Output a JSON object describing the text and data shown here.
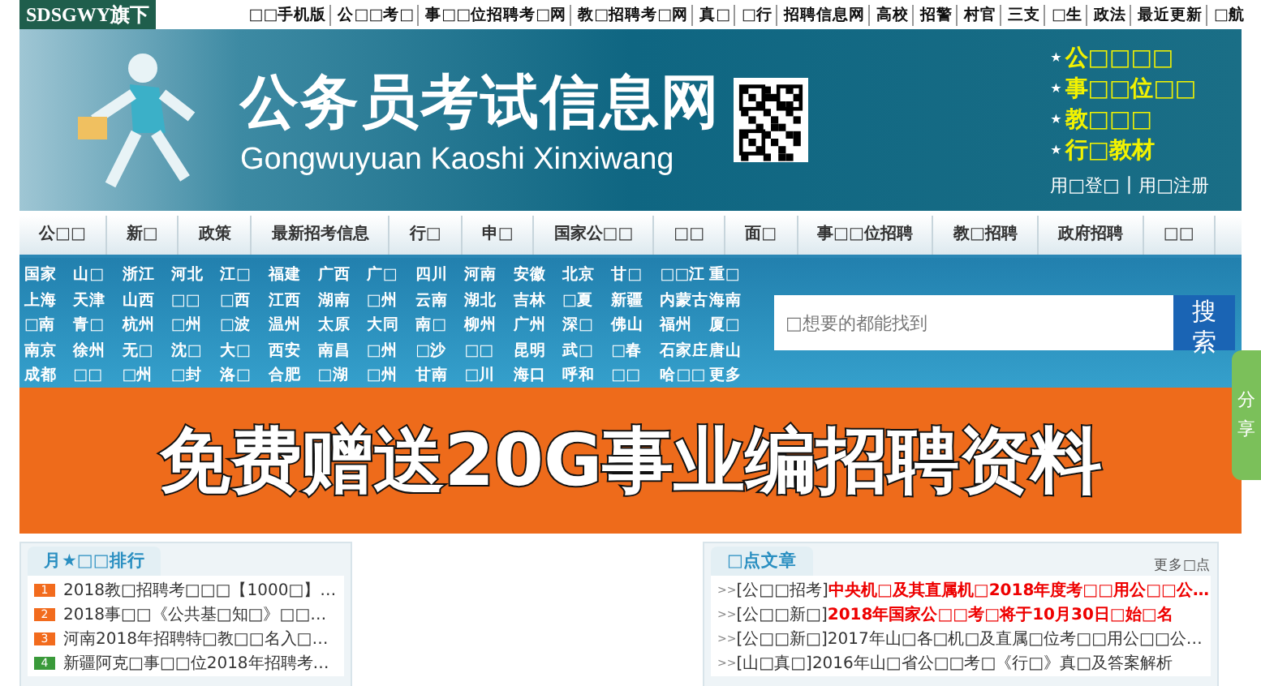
{
  "top_bar": {
    "logo": "SDSGWY旗下",
    "links": [
      "□□手机版",
      "公□□考□",
      "事□□位招聘考□网",
      "教□招聘考□网",
      "真□",
      "□行",
      "招聘信息网",
      "高校",
      "招警",
      "村官",
      "三支",
      "□生",
      "政法",
      "最近更新",
      "□航"
    ]
  },
  "header": {
    "title": "公务员考试信息网",
    "subtitle": "Gongwuyuan Kaoshi Xinxiwang",
    "star": "★",
    "quick_links": [
      "公□□□□",
      "事□□位□□",
      "教□□□",
      "行□教材"
    ],
    "login": "用□登□",
    "separator": "|",
    "register": "用□注册"
  },
  "nav": [
    "公□□",
    "新□",
    "政策",
    "最新招考信息",
    "行□",
    "申□",
    "国家公□□",
    "□□",
    "面□",
    "事□□位招聘",
    "教□招聘",
    "政府招聘",
    "□□"
  ],
  "regions": [
    [
      "国家",
      "山□",
      "浙江",
      "河北",
      "江□",
      "福建",
      "广西",
      "广□",
      "四川",
      "河南",
      "安徽",
      "北京",
      "甘□",
      "□□江",
      "重□"
    ],
    [
      "上海",
      "天津",
      "山西",
      "□□",
      "□西",
      "江西",
      "湖南",
      "□州",
      "云南",
      "湖北",
      "吉林",
      "□夏",
      "新疆",
      "内蒙古",
      "海南"
    ],
    [
      "□南",
      "青□",
      "杭州",
      "□州",
      "□波",
      "温州",
      "太原",
      "大同",
      "南□",
      "柳州",
      "广州",
      "深□",
      "佛山",
      "福州",
      "厦□"
    ],
    [
      "南京",
      "徐州",
      "无□",
      "沈□",
      "大□",
      "西安",
      "南昌",
      "□州",
      "□沙",
      "□□",
      "昆明",
      "武□",
      "□春",
      "石家庄",
      "唐山"
    ],
    [
      "成都",
      "□□",
      "□州",
      "□封",
      "洛□",
      "合肥",
      "□湖",
      "□州",
      "甘南",
      "□川",
      "海口",
      "呼和",
      "□□",
      "哈□□",
      "更多"
    ]
  ],
  "search": {
    "placeholder": "□想要的都能找到",
    "button": "搜索"
  },
  "banner": {
    "text": "免费赠送20G事业编招聘资料"
  },
  "share_tab": "分享",
  "ranking": {
    "title": "月★□□排行",
    "items": [
      {
        "rank": "1",
        "text": "2018教□招聘考□□□【1000□】…",
        "color": "#f26b1d"
      },
      {
        "rank": "2",
        "text": "2018事□□《公共基□知□》□□…",
        "color": "#f26b1d"
      },
      {
        "rank": "3",
        "text": "河南2018年招聘特□教□□名入□…",
        "color": "#f26b1d"
      },
      {
        "rank": "4",
        "text": "新疆阿克□事□□位2018年招聘考…",
        "color": "#3a9a3a"
      }
    ]
  },
  "hot": {
    "title": "□点文章",
    "more": "更多□点",
    "marker": ">>",
    "items": [
      {
        "tag": "[公□□招考]",
        "text": "中央机□及其直属机□2018年度考□□用公□□公…",
        "highlight": true
      },
      {
        "tag": "[公□□新□]",
        "text": "2018年国家公□□考□将于10月30日□始□名",
        "highlight": true
      },
      {
        "tag": "[公□□新□]",
        "text": "2017年山□各□机□及直属□位考□□用公□□公…",
        "highlight": false
      },
      {
        "tag": "[山□真□]",
        "text": "2016年山□省公□□考□《行□》真□及答案解析",
        "highlight": false
      }
    ]
  }
}
